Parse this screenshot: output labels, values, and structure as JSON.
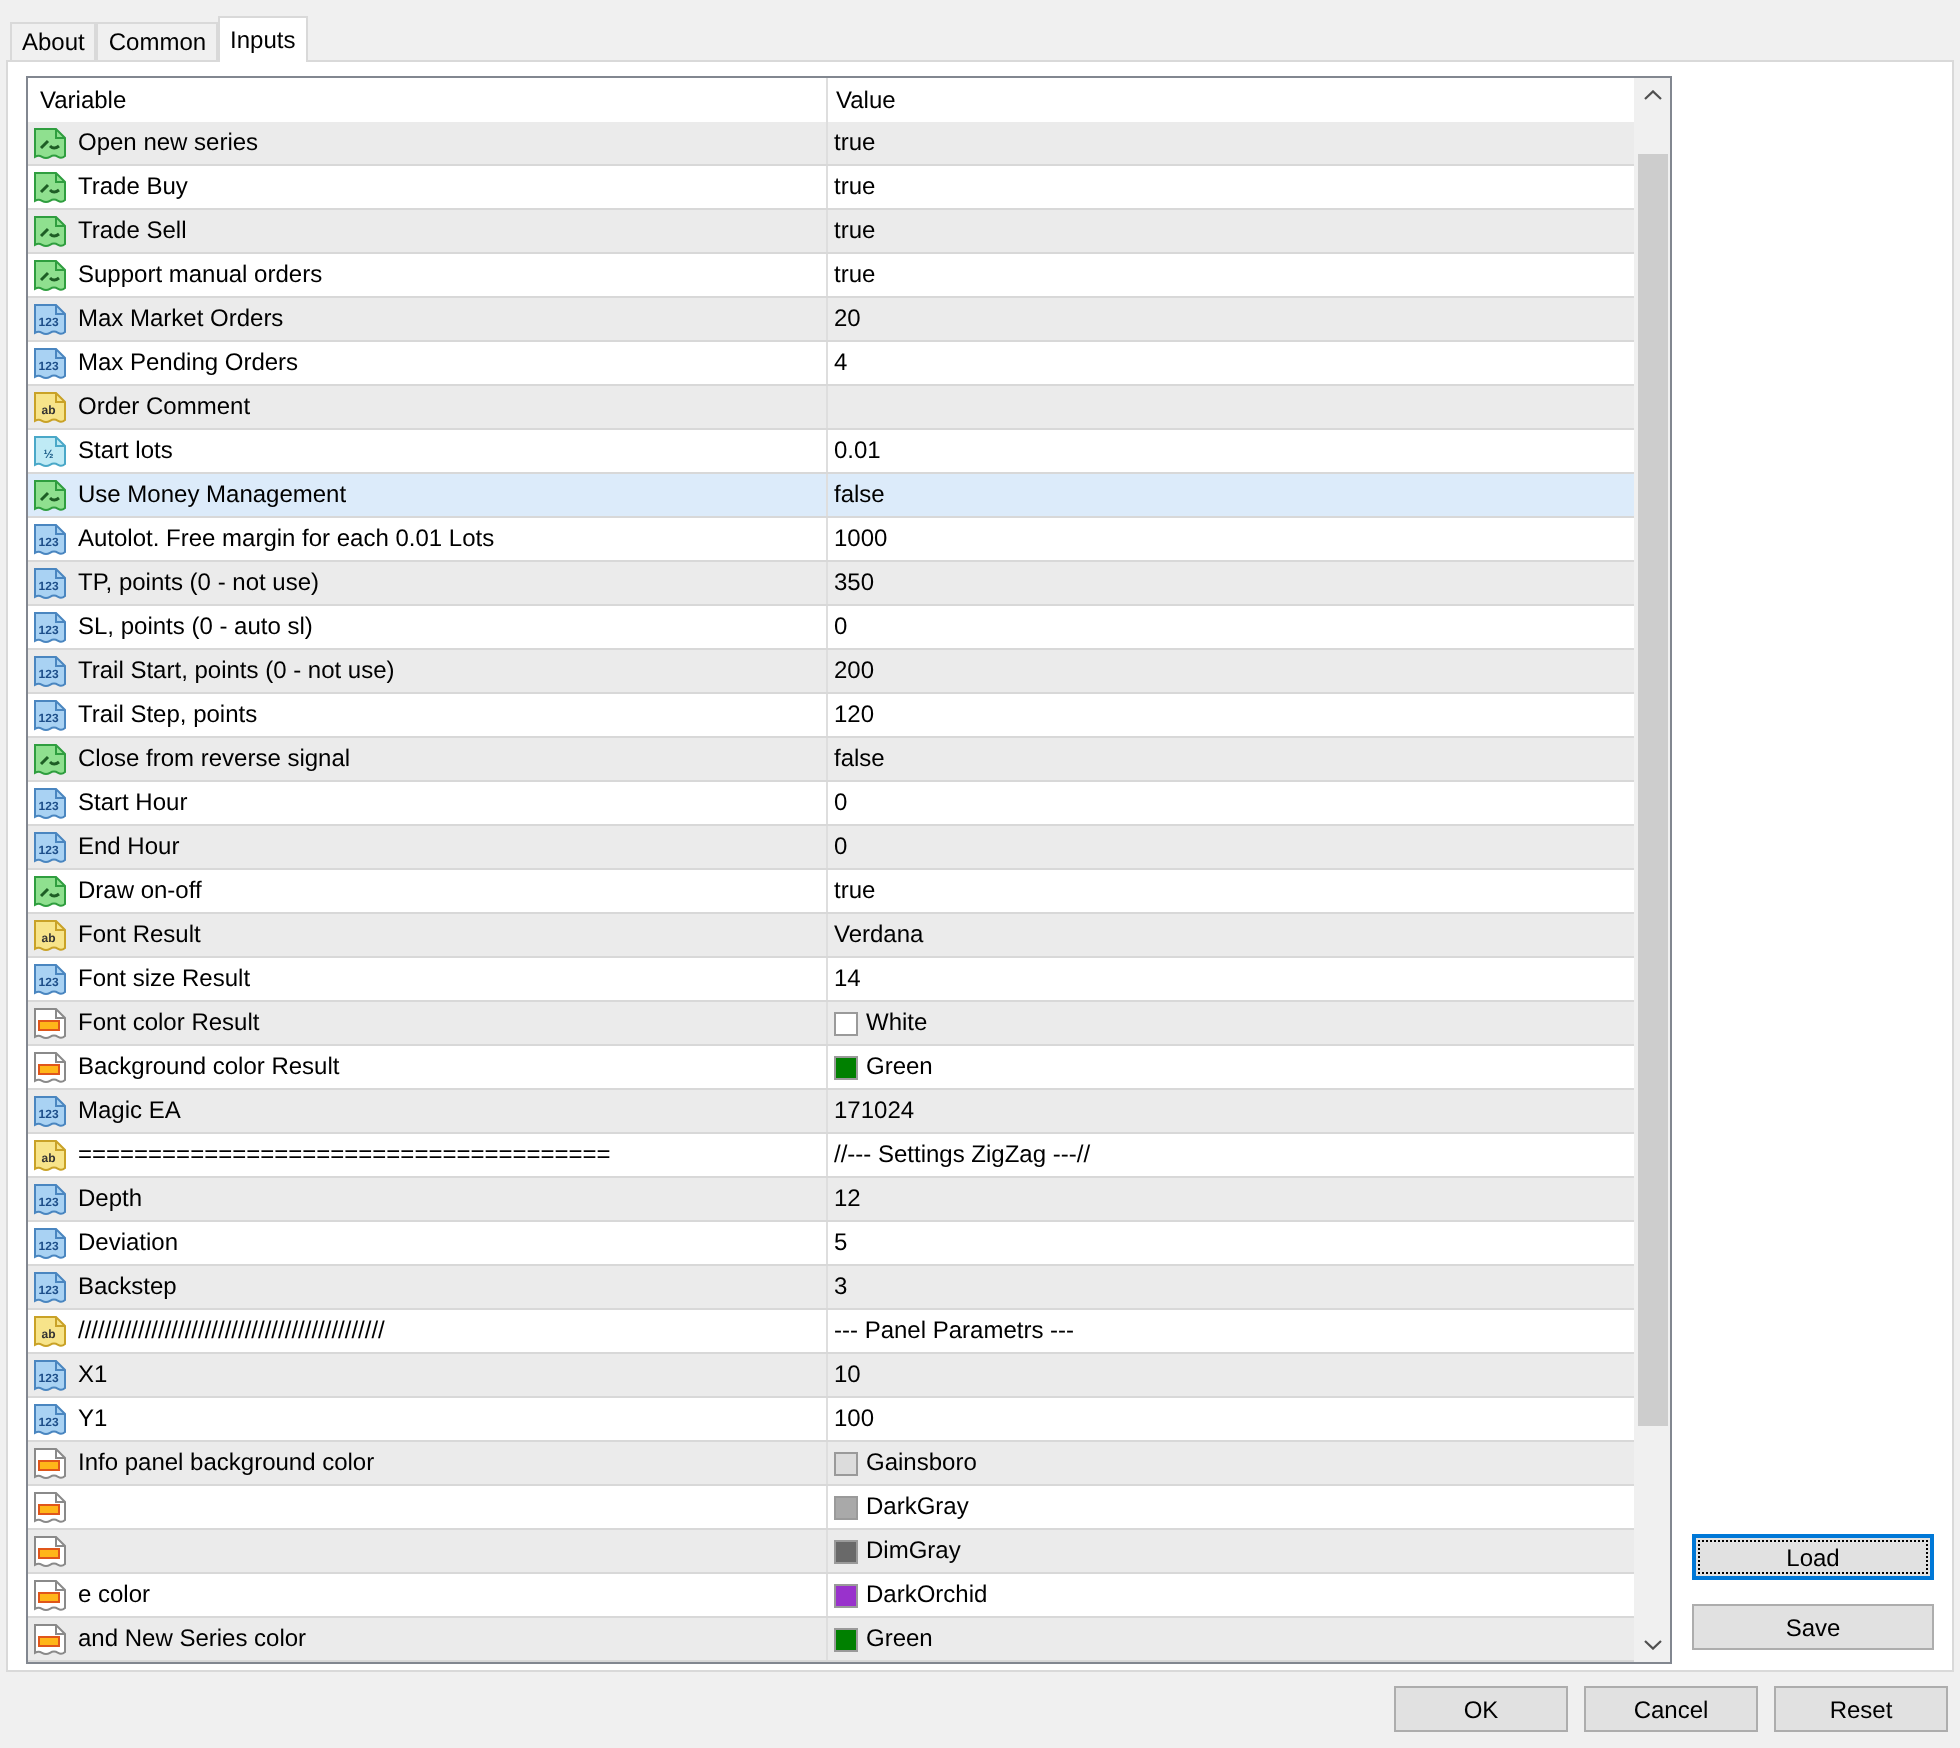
{
  "tabs": [
    {
      "label": "About",
      "selected": false
    },
    {
      "label": "Common",
      "selected": false
    },
    {
      "label": "Inputs",
      "selected": true
    }
  ],
  "table": {
    "columns": [
      "Variable",
      "Value"
    ],
    "rows": [
      {
        "kind": "bool",
        "name": "Open new series",
        "value": "true",
        "selected": false
      },
      {
        "kind": "bool",
        "name": "Trade Buy",
        "value": "true",
        "selected": false
      },
      {
        "kind": "bool",
        "name": "Trade Sell",
        "value": "true",
        "selected": false
      },
      {
        "kind": "bool",
        "name": "Support manual orders",
        "value": "true",
        "selected": false
      },
      {
        "kind": "int",
        "type_tag": "123",
        "name": "Max Market Orders",
        "value": "20",
        "selected": false
      },
      {
        "kind": "int",
        "type_tag": "123",
        "name": "Max Pending Orders",
        "value": "4",
        "selected": false
      },
      {
        "kind": "string",
        "type_tag": "ab",
        "name": "Order Comment",
        "selected": false
      },
      {
        "kind": "double",
        "type_tag": "½",
        "name": "Start lots",
        "value": "0.01",
        "selected": false
      },
      {
        "kind": "bool",
        "name": "Use Money Management",
        "value": "false",
        "selected": true
      },
      {
        "kind": "int",
        "type_tag": "123",
        "name": "Autolot. Free margin for each 0.01 Lots",
        "value": "1000",
        "selected": false
      },
      {
        "kind": "int",
        "type_tag": "123",
        "name": "TP, points (0 - not use)",
        "value": "350",
        "selected": false
      },
      {
        "kind": "int",
        "type_tag": "123",
        "name": "SL, points (0 - auto sl)",
        "value": "0",
        "selected": false
      },
      {
        "kind": "int",
        "type_tag": "123",
        "name": "Trail Start, points (0 - not use)",
        "value": "200",
        "selected": false
      },
      {
        "kind": "int",
        "type_tag": "123",
        "name": "Trail Step, points",
        "value": "120",
        "selected": false
      },
      {
        "kind": "bool",
        "name": "Close from reverse signal",
        "value": "false",
        "selected": false
      },
      {
        "kind": "int",
        "type_tag": "123",
        "name": "Start Hour",
        "value": "0",
        "selected": false
      },
      {
        "kind": "int",
        "type_tag": "123",
        "name": "End Hour",
        "value": "0",
        "selected": false
      },
      {
        "kind": "bool",
        "name": "Draw on-off",
        "value": "true",
        "selected": false
      },
      {
        "kind": "string",
        "type_tag": "ab",
        "name": "Font Result",
        "value": "Verdana",
        "selected": false
      },
      {
        "kind": "int",
        "type_tag": "123",
        "name": "Font size Result",
        "value": "14",
        "selected": false
      },
      {
        "kind": "color",
        "name": "Font color Result",
        "value": "White",
        "color": "#ffffff",
        "selected": false
      },
      {
        "kind": "color",
        "name": "Background color Result",
        "value": "Green",
        "color": "#008000",
        "selected": false
      },
      {
        "kind": "int",
        "type_tag": "123",
        "name": "Magic EA",
        "value": "171024",
        "selected": false
      },
      {
        "kind": "string",
        "type_tag": "ab",
        "name": "======================================",
        "value": "//--- Settings ZigZag ---//",
        "selected": false
      },
      {
        "kind": "int",
        "type_tag": "123",
        "name": "Depth",
        "value": "12",
        "selected": false
      },
      {
        "kind": "int",
        "type_tag": "123",
        "name": "Deviation",
        "value": "5",
        "selected": false
      },
      {
        "kind": "int",
        "type_tag": "123",
        "name": "Backstep",
        "value": "3",
        "selected": false
      },
      {
        "kind": "string",
        "type_tag": "ab",
        "name": "//////////////////////////////////////////////",
        "value": "--- Panel Parametrs ---",
        "selected": false
      },
      {
        "kind": "int",
        "type_tag": "123",
        "name": "X1",
        "value": "10",
        "selected": false
      },
      {
        "kind": "int",
        "type_tag": "123",
        "name": "Y1",
        "value": "100",
        "selected": false
      },
      {
        "kind": "color",
        "name": "Info panel background color",
        "value": "Gainsboro",
        "color": "#dcdcdc",
        "selected": false
      },
      {
        "kind": "color",
        "value": "DarkGray",
        "color": "#a9a9a9",
        "selected": false
      },
      {
        "kind": "color",
        "value": "DimGray",
        "color": "#696969",
        "selected": false
      },
      {
        "kind": "color",
        "name": "e color",
        "value": "DarkOrchid",
        "color": "#9932cc",
        "selected": false
      },
      {
        "kind": "color",
        "name": "and New Series color",
        "value": "Green",
        "color": "#008000",
        "selected": false
      }
    ]
  },
  "side_buttons": [
    {
      "label": "Load",
      "focused": true
    },
    {
      "label": "Save",
      "focused": false
    }
  ],
  "buttons": [
    "OK",
    "Cancel",
    "Reset"
  ]
}
